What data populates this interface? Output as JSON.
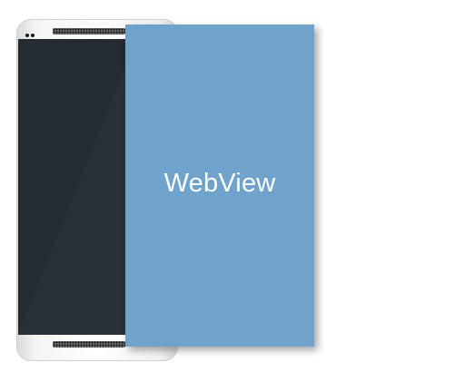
{
  "webview": {
    "label": "WebView",
    "background_color": "#6fa3cc"
  },
  "phone": {
    "screen_color": "#252b33",
    "back_nav_glyph": "<",
    "icons": [
      "camera-icon",
      "speaker-grille-icon",
      "back-arrow-icon"
    ]
  }
}
